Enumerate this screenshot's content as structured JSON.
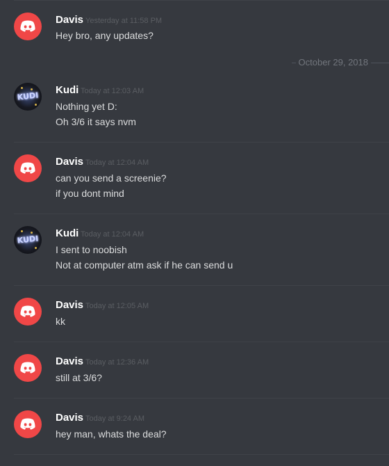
{
  "date_divider": "October 29, 2018",
  "messages": [
    {
      "author": "Davis",
      "timestamp": "Yesterday at 11:58 PM",
      "avatar": "discord-logo-icon",
      "lines": [
        "Hey bro, any updates?"
      ]
    },
    {
      "author": "Kudi",
      "timestamp": "Today at 12:03 AM",
      "avatar": "kudi-avatar",
      "lines": [
        "Nothing yet D:",
        "Oh 3/6 it says nvm"
      ]
    },
    {
      "author": "Davis",
      "timestamp": "Today at 12:04 AM",
      "avatar": "discord-logo-icon",
      "lines": [
        "can you send a screenie?",
        "if you dont mind"
      ]
    },
    {
      "author": "Kudi",
      "timestamp": "Today at 12:04 AM",
      "avatar": "kudi-avatar",
      "lines": [
        "I sent to noobish",
        "Not at computer atm ask if he can send u"
      ]
    },
    {
      "author": "Davis",
      "timestamp": "Today at 12:05 AM",
      "avatar": "discord-logo-icon",
      "lines": [
        "kk"
      ]
    },
    {
      "author": "Davis",
      "timestamp": "Today at 12:36 AM",
      "avatar": "discord-logo-icon",
      "lines": [
        "still at 3/6?"
      ]
    },
    {
      "author": "Davis",
      "timestamp": "Today at 9:24 AM",
      "avatar": "discord-logo-icon",
      "lines": [
        "hey man, whats the deal?"
      ]
    }
  ],
  "colors": {
    "background": "#36393f",
    "discord_red": "#f04747",
    "text": "#dcddde",
    "timestamp": "#5b5e63"
  }
}
